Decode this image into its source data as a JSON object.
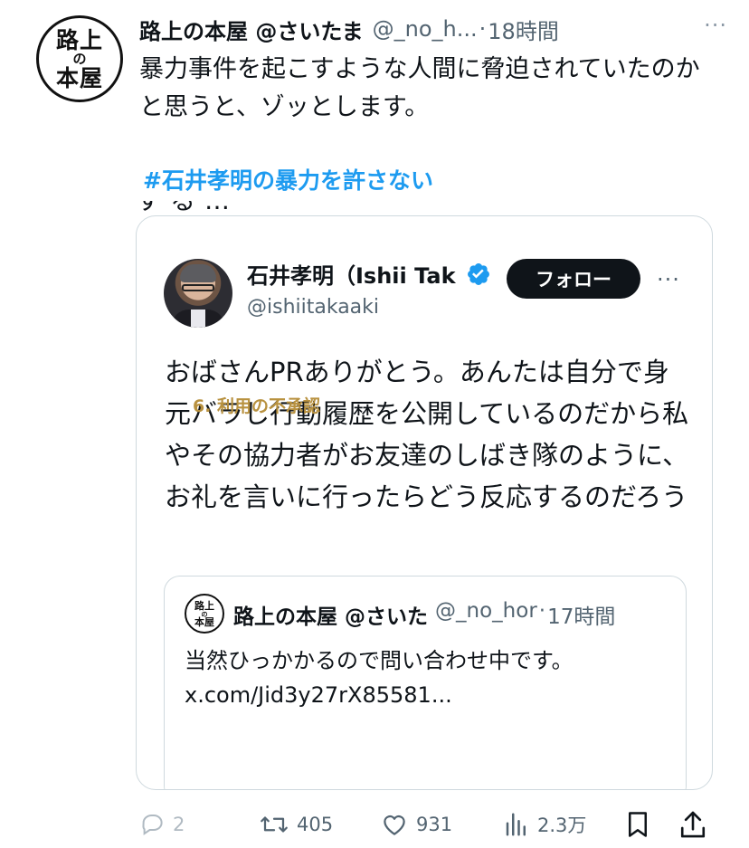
{
  "tweet": {
    "avatar_text": [
      "路上",
      "の",
      "本屋"
    ],
    "display_name": "路上の本屋 @さいたま",
    "handle": "@_no_h...",
    "dot": "·",
    "time": "18時間",
    "more": "···",
    "text": "暴力事件を起こすような人間に脅迫されていたのかと思うと、ゾッとします。",
    "hashtag": "#石井孝明の暴力を許さない",
    "clipped_line": "する…"
  },
  "quoted": {
    "display_name": "石井孝明（Ishii Tak",
    "handle": "@ishiitakaaki",
    "follow_label": "フォロー",
    "more": "···",
    "text": "おばさんPRありがとう。あんたは自分で身元バラし行動履歴を公開しているのだから私やその協力者がお友達のしばき隊のように、お礼を言いに行ったらどう反応するのだろう",
    "verified_color": "#1d9bf0"
  },
  "inner_quote": {
    "avatar_text": [
      "路上",
      "の",
      "本屋"
    ],
    "display_name": "路上の本屋 @さいた",
    "handle": "@_no_hor",
    "dot": "·",
    "time": "17時間",
    "text": "当然ひっかかるので問い合わせ中です。",
    "link": "x.com/Jid3y27rX85581...",
    "card_title": "6. 利用の不承認"
  },
  "actions": {
    "reply_count": "2",
    "retweet_count": "405",
    "like_count": "931",
    "views_count": "2.3万"
  }
}
